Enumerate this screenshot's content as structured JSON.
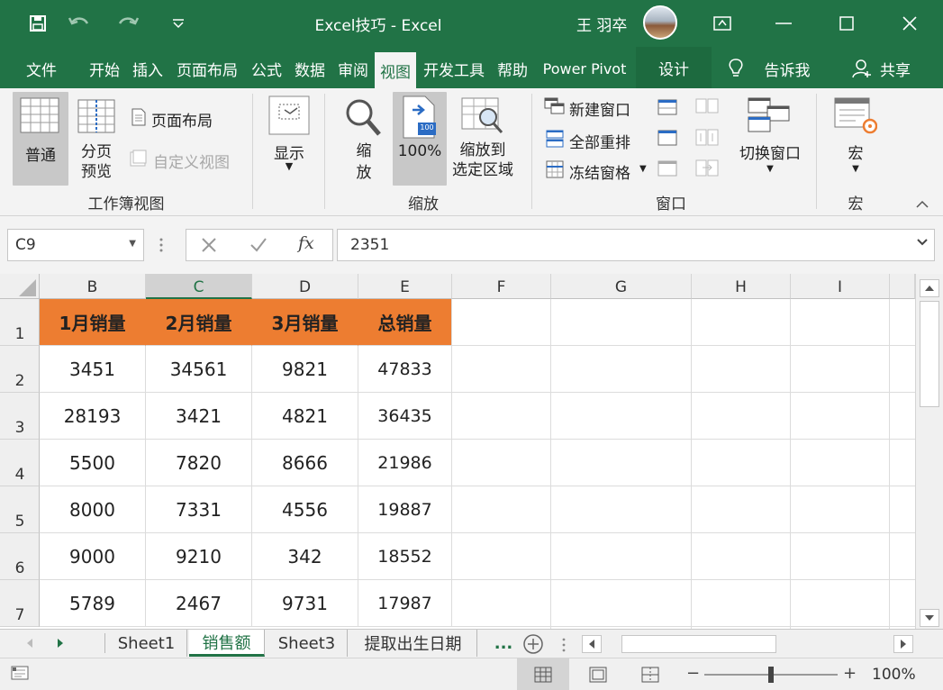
{
  "titlebar": {
    "title": "Excel技巧  -  Excel",
    "user": "王 羽卒"
  },
  "tabs": [
    {
      "label": "文件"
    },
    {
      "label": "开始"
    },
    {
      "label": "插入"
    },
    {
      "label": "页面布局"
    },
    {
      "label": "公式"
    },
    {
      "label": "数据"
    },
    {
      "label": "审阅"
    },
    {
      "label": "视图"
    },
    {
      "label": "开发工具"
    },
    {
      "label": "帮助"
    },
    {
      "label": "Power Pivot"
    },
    {
      "label": "设计"
    },
    {
      "label": "告诉我"
    },
    {
      "label": "共享"
    }
  ],
  "ribbon": {
    "normal": "普通",
    "page_break": [
      "分页",
      "预览"
    ],
    "page_layout": "页面布局",
    "custom_view": "自定义视图",
    "group_workbook_views": "工作簿视图",
    "show": "显示",
    "zoom": [
      "缩",
      "放"
    ],
    "zoom_100": "100%",
    "zoom_100_icon_text": "100",
    "zoom_selection": [
      "缩放到",
      "选定区域"
    ],
    "group_zoom": "缩放",
    "new_window": "新建窗口",
    "arrange_all": "全部重排",
    "freeze_panes": "冻结窗格",
    "switch_windows": "切换窗口",
    "group_window": "窗口",
    "macros": "宏",
    "group_macros": "宏"
  },
  "formula_bar": {
    "name_box": "C9",
    "formula": "2351"
  },
  "columns": [
    "B",
    "C",
    "D",
    "E",
    "F",
    "G",
    "H",
    "I"
  ],
  "rows": [
    "1",
    "2",
    "3",
    "4",
    "5",
    "6",
    "7"
  ],
  "table": {
    "headers": [
      "1月销量",
      "2月销量",
      "3月销量",
      "总销量"
    ],
    "data": [
      [
        "3451",
        "34561",
        "9821",
        "47833"
      ],
      [
        "28193",
        "3421",
        "4821",
        "36435"
      ],
      [
        "5500",
        "7820",
        "8666",
        "21986"
      ],
      [
        "8000",
        "7331",
        "4556",
        "19887"
      ],
      [
        "9000",
        "9210",
        "342",
        "18552"
      ],
      [
        "5789",
        "2467",
        "9731",
        "17987"
      ]
    ]
  },
  "sheets": [
    "Sheet1",
    "销售额",
    "Sheet3",
    "提取出生日期"
  ],
  "active_sheet": "销售额",
  "sheet_more": "...",
  "status": {
    "zoom": "100%",
    "zoom_fraction": 0.5
  },
  "colors": {
    "brand": "#217346",
    "header_fill": "#ed7d31"
  }
}
